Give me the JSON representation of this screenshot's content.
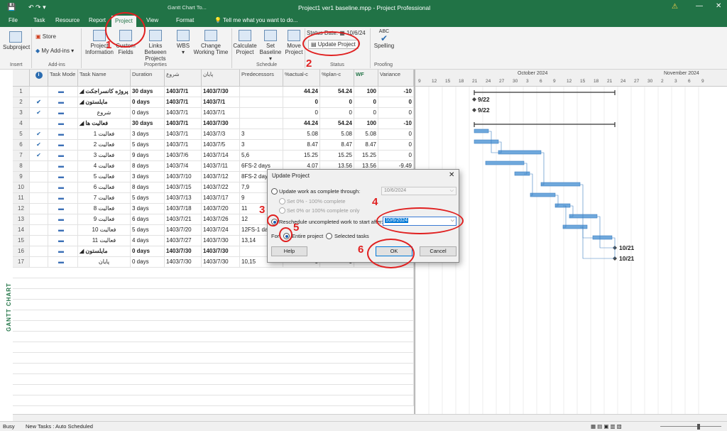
{
  "titlebar": {
    "doc_title": "Project1 ver1 baseline.mpp  -  Project Professional",
    "tool_tab": "Gantt Chart To...",
    "quick_access": "↶  ↷  ▾"
  },
  "tabs": [
    {
      "label": "File"
    },
    {
      "label": "Task"
    },
    {
      "label": "Resource"
    },
    {
      "label": "Report"
    },
    {
      "label": "Project"
    },
    {
      "label": "View"
    },
    {
      "label": "Format"
    }
  ],
  "tell_me": "Tell me what you want to do...",
  "ribbon": {
    "subproject": "Subproject",
    "store": "Store",
    "addins": "My Add-ins",
    "project_info": "Project Information",
    "custom_fields": "Custom Fields",
    "links_between": "Links Between Projects",
    "wbs": "WBS",
    "change_working_time": "Change Working Time",
    "calculate_project": "Calculate Project",
    "set_baseline": "Set Baseline",
    "move_project": "Move Project",
    "status_date_label": "Status Date:",
    "status_date": "10/6/24",
    "update_project": "Update Project",
    "spelling": "Spelling",
    "groups": {
      "insert": "Insert",
      "addins": "Add-ins",
      "properties": "Properties",
      "schedule": "Schedule",
      "status": "Status",
      "proofing": "Proofing"
    }
  },
  "side_label": "GANTT CHART",
  "columns": {
    "mode": "Task Mode",
    "name": "Task Name",
    "duration": "Duration",
    "start": "شروع",
    "finish": "پایان",
    "predecessors": "Predecessors",
    "actual": "%actual-c",
    "plan": "%plan-c",
    "wf": "WF",
    "variance": "Variance"
  },
  "rows": [
    {
      "id": "1",
      "check": "",
      "name": "پروژه کانسراجکت ◢",
      "dur": "30 days",
      "start": "1403/7/1",
      "finish": "1403/7/30",
      "pred": "",
      "act": "44.24",
      "plan": "54.24",
      "wf": "100",
      "var": "-10",
      "bold": true
    },
    {
      "id": "2",
      "check": "✔",
      "name": "مایلستون ◢",
      "dur": "0 days",
      "start": "1403/7/1",
      "finish": "1403/7/1",
      "pred": "",
      "act": "0",
      "plan": "0",
      "wf": "0",
      "var": "0",
      "bold": true
    },
    {
      "id": "3",
      "check": "✔",
      "name": "شروع",
      "dur": "0 days",
      "start": "1403/7/1",
      "finish": "1403/7/1",
      "pred": "",
      "act": "0",
      "plan": "0",
      "wf": "0",
      "var": "0",
      "bold": false
    },
    {
      "id": "4",
      "check": "",
      "name": "فعالیت ها ◢",
      "dur": "30 days",
      "start": "1403/7/1",
      "finish": "1403/7/30",
      "pred": "",
      "act": "44.24",
      "plan": "54.24",
      "wf": "100",
      "var": "-10",
      "bold": true
    },
    {
      "id": "5",
      "check": "✔",
      "name": "فعالیت 1",
      "dur": "3 days",
      "start": "1403/7/1",
      "finish": "1403/7/3",
      "pred": "3",
      "act": "5.08",
      "plan": "5.08",
      "wf": "5.08",
      "var": "0",
      "bold": false
    },
    {
      "id": "6",
      "check": "✔",
      "name": "فعالیت 2",
      "dur": "5 days",
      "start": "1403/7/1",
      "finish": "1403/7/5",
      "pred": "3",
      "act": "8.47",
      "plan": "8.47",
      "wf": "8.47",
      "var": "0",
      "bold": false
    },
    {
      "id": "7",
      "check": "✔",
      "name": "فعالیت 3",
      "dur": "9 days",
      "start": "1403/7/6",
      "finish": "1403/7/14",
      "pred": "5,6",
      "act": "15.25",
      "plan": "15.25",
      "wf": "15.25",
      "var": "0",
      "bold": false
    },
    {
      "id": "8",
      "check": "",
      "name": "فعالیت 4",
      "dur": "8 days",
      "start": "1403/7/4",
      "finish": "1403/7/11",
      "pred": "6FS-2 days",
      "act": "4.07",
      "plan": "13.56",
      "wf": "13.56",
      "var": "-9.49",
      "bold": false
    },
    {
      "id": "9",
      "check": "",
      "name": "فعالیت 5",
      "dur": "3 days",
      "start": "1403/7/10",
      "finish": "1403/7/12",
      "pred": "8FS-2 day",
      "act": "",
      "plan": "",
      "wf": "",
      "var": "",
      "bold": false
    },
    {
      "id": "10",
      "check": "",
      "name": "فعالیت 6",
      "dur": "8 days",
      "start": "1403/7/15",
      "finish": "1403/7/22",
      "pred": "7,9",
      "act": "",
      "plan": "",
      "wf": "",
      "var": "",
      "bold": false
    },
    {
      "id": "11",
      "check": "",
      "name": "فعالیت 7",
      "dur": "5 days",
      "start": "1403/7/13",
      "finish": "1403/7/17",
      "pred": "9",
      "act": "",
      "plan": "",
      "wf": "",
      "var": "",
      "bold": false
    },
    {
      "id": "12",
      "check": "",
      "name": "فعالیت 8",
      "dur": "3 days",
      "start": "1403/7/18",
      "finish": "1403/7/20",
      "pred": "11",
      "act": "",
      "plan": "",
      "wf": "",
      "var": "",
      "bold": false
    },
    {
      "id": "13",
      "check": "",
      "name": "فعالیت 9",
      "dur": "6 days",
      "start": "1403/7/21",
      "finish": "1403/7/26",
      "pred": "12",
      "act": "",
      "plan": "",
      "wf": "",
      "var": "",
      "bold": false
    },
    {
      "id": "14",
      "check": "",
      "name": "فعالیت 10",
      "dur": "5 days",
      "start": "1403/7/20",
      "finish": "1403/7/24",
      "pred": "12FS-1 da",
      "act": "",
      "plan": "",
      "wf": "",
      "var": "",
      "bold": false
    },
    {
      "id": "15",
      "check": "",
      "name": "فعالیت 11",
      "dur": "4 days",
      "start": "1403/7/27",
      "finish": "1403/7/30",
      "pred": "13,14",
      "act": "",
      "plan": "",
      "wf": "",
      "var": "",
      "bold": false
    },
    {
      "id": "16",
      "check": "",
      "name": "مایلستون ◢",
      "dur": "0 days",
      "start": "1403/7/30",
      "finish": "1403/7/30",
      "pred": "",
      "act": "",
      "plan": "",
      "wf": "",
      "var": "",
      "bold": true
    },
    {
      "id": "17",
      "check": "",
      "name": "پایان",
      "dur": "0 days",
      "start": "1403/7/30",
      "finish": "1403/7/30",
      "pred": "10,15",
      "act": "0",
      "plan": "0",
      "wf": "",
      "var": "",
      "bold": false
    }
  ],
  "timescale": {
    "month1": "October 2024",
    "month2": "November 2024",
    "days": [
      "9",
      "12",
      "15",
      "18",
      "21",
      "24",
      "27",
      "30",
      "3",
      "6",
      "9",
      "12",
      "15",
      "18",
      "21",
      "24",
      "27",
      "30",
      "2",
      "3",
      "6",
      "9"
    ]
  },
  "milestones": {
    "m1": "9/22",
    "m2": "9/22",
    "m3": "10/21",
    "m4": "10/21"
  },
  "dialog": {
    "title": "Update Project",
    "opt1": "Update work as complete through:",
    "opt1_date": "10/6/2024",
    "sub1": "Set 0% - 100% complete",
    "sub2": "Set 0% or 100% complete only",
    "opt2": "Reschedule uncompleted work to start after:",
    "opt2_date": "10/6/2024",
    "for": "For:",
    "entire": "Entire project",
    "selected": "Selected tasks",
    "help": "Help",
    "ok": "OK",
    "cancel": "Cancel"
  },
  "annotations": [
    "1",
    "2",
    "3",
    "4",
    "5",
    "6"
  ],
  "status": {
    "left": "Busy",
    "mode": "New Tasks : Auto Scheduled"
  },
  "accent": "#217346",
  "bar_color": "#6fa8dc",
  "annot_color": "#e02020"
}
